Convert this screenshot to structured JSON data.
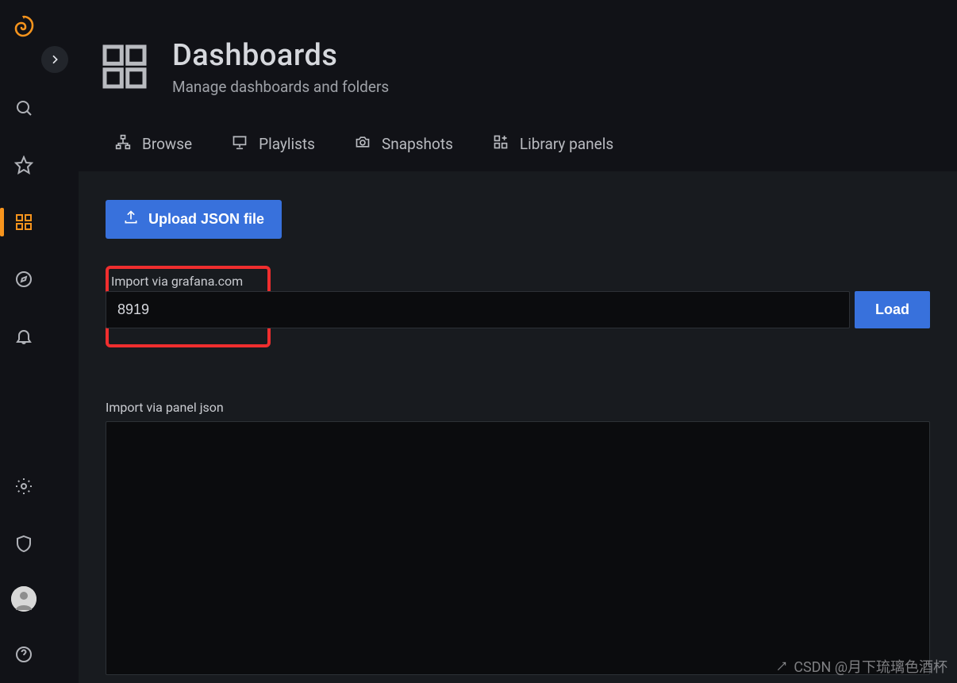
{
  "header": {
    "title": "Dashboards",
    "subtitle": "Manage dashboards and folders"
  },
  "tabs": {
    "browse": "Browse",
    "playlists": "Playlists",
    "snapshots": "Snapshots",
    "library_panels": "Library panels"
  },
  "actions": {
    "upload_label": "Upload JSON file",
    "load_label": "Load"
  },
  "import_grafana": {
    "label": "Import via grafana.com",
    "value": "8919"
  },
  "import_panel_json": {
    "label": "Import via panel json",
    "value": ""
  },
  "watermark": "CSDN @月下琉璃色酒杯"
}
